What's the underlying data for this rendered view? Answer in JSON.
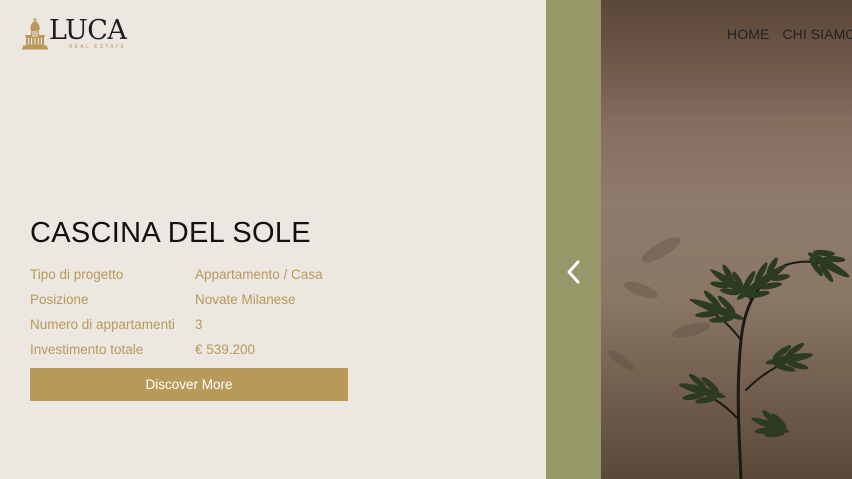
{
  "brand": {
    "name": "LUCA",
    "tagline": "REAL ESTATE",
    "logo_icon": "cathedral-icon",
    "gold_color": "#b8995a"
  },
  "nav": {
    "items": [
      "HOME",
      "CHI SIAMO"
    ]
  },
  "project": {
    "title": "CASCINA DEL SOLE",
    "details": [
      {
        "label": "Tipo di progetto",
        "value": "Appartamento / Casa"
      },
      {
        "label": "Posizione",
        "value": "Novate Milanese"
      },
      {
        "label": "Numero di appartamenti",
        "value": "3"
      },
      {
        "label": "Investimento totale",
        "value": "€ 539.200"
      }
    ],
    "cta_label": "Discover More"
  },
  "slider": {
    "prev_icon": "chevron-left-icon",
    "band_color": "#979868"
  }
}
